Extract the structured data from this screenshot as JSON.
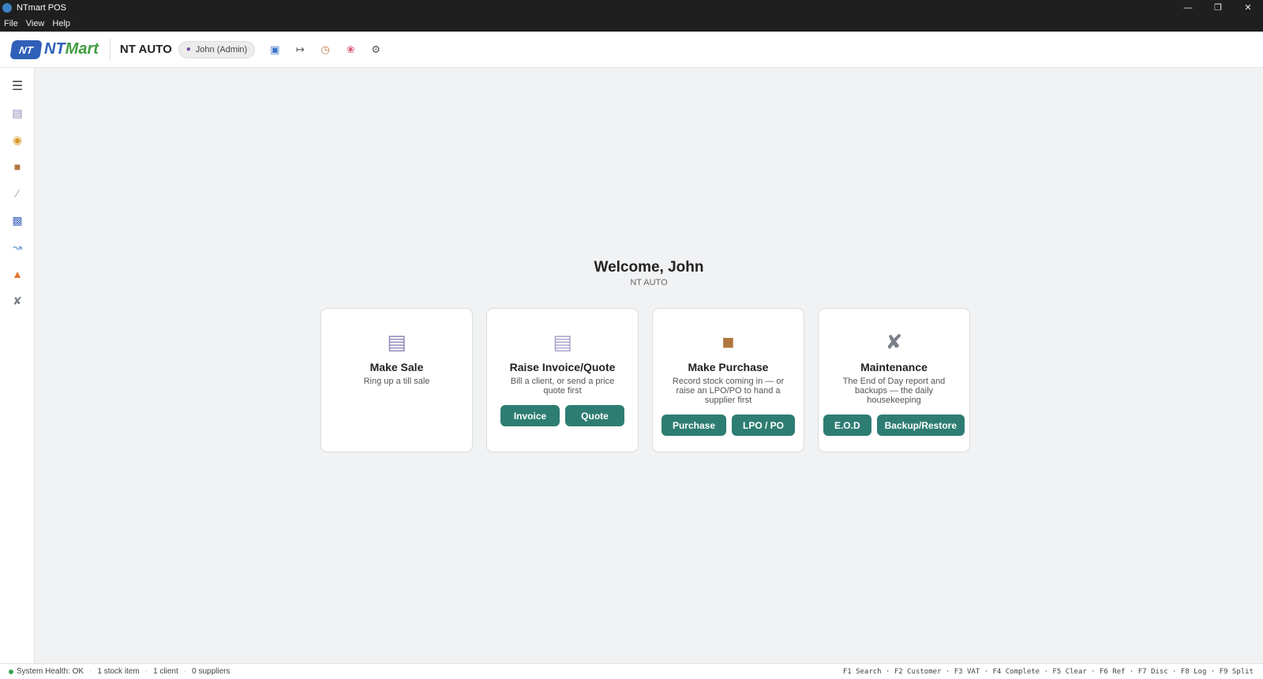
{
  "window": {
    "title": "NTmart POS",
    "controls": {
      "minimize": "—",
      "restore": "❐",
      "close": "✕"
    }
  },
  "menu": [
    "File",
    "View",
    "Help"
  ],
  "header": {
    "logo_badge": "NT",
    "logo_nt": "NT",
    "logo_mart": "Mart",
    "store_name": "NT AUTO",
    "user": "John (Admin)",
    "icons": [
      "id-card-icon",
      "logout-icon",
      "clock-icon",
      "theme-icon",
      "settings-icon"
    ]
  },
  "sidebar": {
    "icons": [
      "menu-icon",
      "receipt-icon",
      "money-bag-icon",
      "package-icon",
      "wrench-icon",
      "bar-chart-icon",
      "line-chart-icon",
      "cone-icon",
      "tools-icon"
    ]
  },
  "main": {
    "welcome": "Welcome, John",
    "subtitle": "NT AUTO",
    "cards": [
      {
        "icon": "receipt-icon",
        "title": "Make Sale",
        "desc": "Ring up a till sale",
        "buttons": []
      },
      {
        "icon": "document-icon",
        "title": "Raise Invoice/Quote",
        "desc": "Bill a client, or send a price quote first",
        "buttons": [
          "Invoice",
          "Quote"
        ]
      },
      {
        "icon": "package-icon",
        "title": "Make Purchase",
        "desc": "Record stock coming in — or raise an LPO/PO to hand a supplier first",
        "buttons": [
          "Purchase",
          "LPO / PO"
        ]
      },
      {
        "icon": "tools-icon",
        "title": "Maintenance",
        "desc": "The End of Day report and backups — the daily housekeeping",
        "buttons": [
          "E.O.D",
          "Backup/Restore"
        ]
      }
    ]
  },
  "status": {
    "health": "System Health: OK",
    "stock": "1 stock item",
    "clients": "1 client",
    "suppliers": "0 suppliers",
    "shortcuts": "F1 Search · F2 Customer · F3 VAT · F4 Complete · F5 Clear · F6 Ref · F7 Disc · F8 Log · F9 Split",
    "health_color": "#3aa55a"
  },
  "colors": {
    "accent": "#2e7d72",
    "titlebar": "#1f1f1f",
    "brand_blue": "#2f5fb8",
    "brand_green": "#3f9c3f"
  }
}
